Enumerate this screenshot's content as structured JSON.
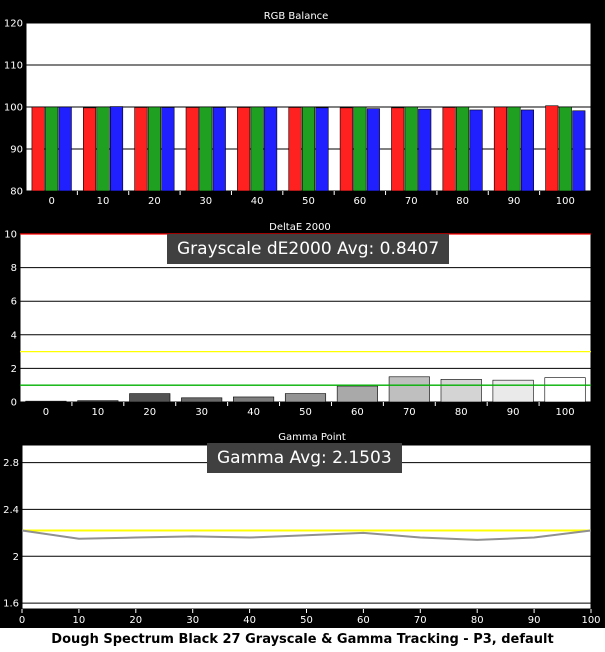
{
  "caption": "Dough Spectrum Black 27 Grayscale & Gamma Tracking - P3, default",
  "colors": {
    "red": "#ff2020",
    "green": "#20a020",
    "blue": "#2020ff",
    "background": "#000000",
    "plot": "#ffffff",
    "limit_red": "#ff0000",
    "limit_yellow": "#ffff00",
    "limit_green": "#00b000",
    "gamma_target": "#ffff00",
    "gamma_actual": "#909090"
  },
  "chart_data": [
    {
      "type": "bar",
      "title": "RGB Balance",
      "categories": [
        "0",
        "10",
        "20",
        "30",
        "40",
        "50",
        "60",
        "70",
        "80",
        "90",
        "100"
      ],
      "series": [
        {
          "color": "red",
          "values": [
            100,
            99.8,
            99.9,
            99.9,
            99.9,
            99.9,
            99.8,
            99.8,
            99.9,
            100,
            100.3
          ]
        },
        {
          "color": "green",
          "values": [
            100,
            100,
            100,
            100,
            100,
            100,
            100,
            100,
            100,
            100,
            100
          ]
        },
        {
          "color": "blue",
          "values": [
            100,
            100.1,
            99.9,
            99.9,
            100,
            99.8,
            99.6,
            99.5,
            99.3,
            99.3,
            99.1
          ]
        }
      ],
      "yticks": [
        80,
        90,
        100,
        110,
        120
      ],
      "ylim": [
        80,
        120
      ]
    },
    {
      "type": "bar",
      "title": "DeltaE 2000",
      "annotation": "Grayscale dE2000 Avg: 0.8407",
      "categories": [
        "0",
        "10",
        "20",
        "30",
        "40",
        "50",
        "60",
        "70",
        "80",
        "90",
        "100"
      ],
      "values": [
        0.05,
        0.08,
        0.5,
        0.25,
        0.3,
        0.5,
        0.95,
        1.5,
        1.35,
        1.3,
        1.45
      ],
      "reference_lines": [
        10,
        3,
        1
      ],
      "yticks": [
        0,
        2,
        4,
        6,
        8,
        10
      ],
      "ylim": [
        0,
        10
      ]
    },
    {
      "type": "line",
      "title": "Gamma Point",
      "annotation": "Gamma Avg: 2.1503",
      "x": [
        0,
        10,
        20,
        30,
        40,
        50,
        60,
        70,
        80,
        90,
        100
      ],
      "target": [
        2.22,
        2.22,
        2.22,
        2.22,
        2.22,
        2.22,
        2.22,
        2.22,
        2.22,
        2.22,
        2.22
      ],
      "values": [
        2.22,
        2.15,
        2.16,
        2.17,
        2.16,
        2.18,
        2.2,
        2.16,
        2.14,
        2.16,
        2.22
      ],
      "yticks": [
        1.6,
        2,
        2.4,
        2.8
      ],
      "ylim": [
        1.55,
        2.95
      ],
      "xticks": [
        0,
        10,
        20,
        30,
        40,
        50,
        60,
        70,
        80,
        90,
        100
      ]
    }
  ]
}
